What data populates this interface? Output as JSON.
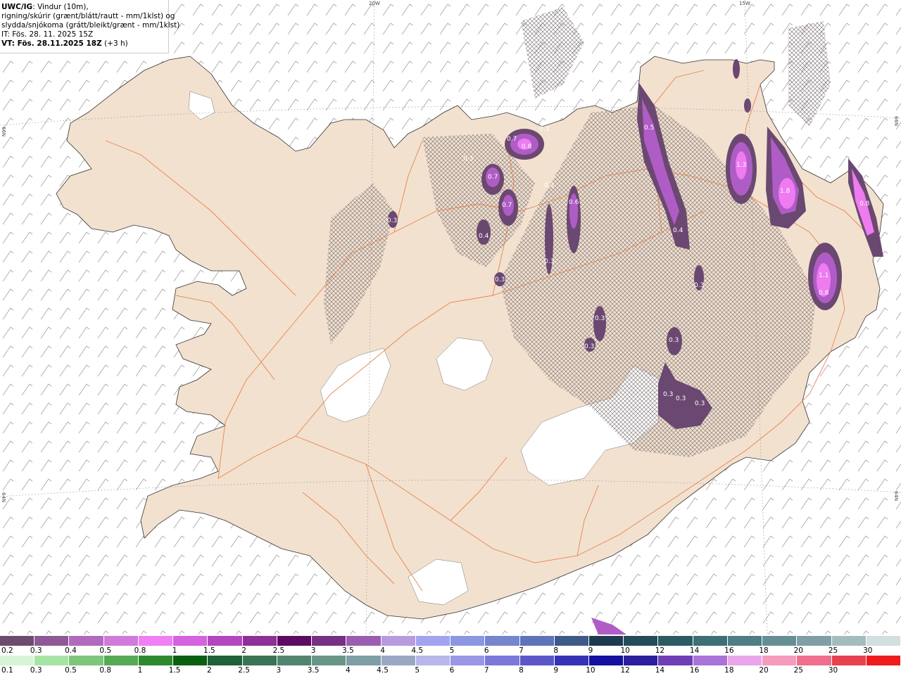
{
  "header": {
    "model": "UWC/IG",
    "line1_rest": ": Vindur (10m),",
    "line2": "rigning/skúrir (grænt/blátt/rautt - mm/1klst) og",
    "line3": "slydda/snjókoma (grátt/bleikt/grænt - mm/1klst)",
    "it_line": "IT: Fös. 28. 11. 2025 15Z",
    "vt_bold": "VT: Fös. 28.11.2025 18Z",
    "vt_offset": " (+3 h)"
  },
  "grid_labels": {
    "top_20w": "20W",
    "top_15w": "15W",
    "left_66n": "66N",
    "right_66n": "66N",
    "left_64n": "64N",
    "right_64n": "64N"
  },
  "precip_labels": [
    "0.7",
    "0.8",
    "0.3",
    "0.3",
    "0.7",
    "0.3",
    "0.7",
    "0.4",
    "0.3",
    "0.6",
    "0.3",
    "0.3",
    "0.5",
    "0.4",
    "1.3",
    "1.8",
    "0.8",
    "1.1",
    "0.8",
    "0.3",
    "0.3",
    "0.3",
    "0.3",
    "0.3",
    "0.3",
    "0.3"
  ],
  "colors": {
    "land": "#f2e1cf",
    "roads": "#e8834f",
    "glacier": "#ffffff",
    "ocean": "#ffffff",
    "hatch": "#8a7f80",
    "precip_light": "#6b4871",
    "precip_mid": "#b05cc6",
    "precip_high": "#ee7bf0"
  },
  "snow_scale": {
    "ticks": [
      "0.2",
      "0.3",
      "0.4",
      "0.5",
      "0.8",
      "1",
      "1.5",
      "2",
      "2.5",
      "3",
      "3.5",
      "4",
      "4.5",
      "5",
      "6",
      "7",
      "8",
      "9",
      "10",
      "12",
      "14",
      "16",
      "18",
      "20",
      "25",
      "30"
    ],
    "colors": [
      "#6b4b6e",
      "#8e5a96",
      "#b16abd",
      "#d07ad9",
      "#f07ff5",
      "#d562df",
      "#b447bd",
      "#8f2f98",
      "#5c0b62",
      "#763084",
      "#9a5db1",
      "#b79bdf",
      "#a3a3f0",
      "#8c97e2",
      "#7586cf",
      "#5f74b8",
      "#3e5a88",
      "#1d3a4f",
      "#234c58",
      "#2d5b64",
      "#3d6f75",
      "#4f7c85",
      "#668e95",
      "#809fa5",
      "#a5bcbf",
      "#d3dedf"
    ]
  },
  "rain_scale": {
    "ticks": [
      "0.1",
      "0.3",
      "0.5",
      "0.8",
      "1",
      "1.5",
      "2",
      "2.5",
      "3",
      "3.5",
      "4",
      "4.5",
      "5",
      "6",
      "7",
      "8",
      "9",
      "10",
      "12",
      "14",
      "16",
      "18",
      "20",
      "25",
      "30"
    ],
    "colors": [
      "#d6f5d6",
      "#a8e3a6",
      "#7ec67d",
      "#58a956",
      "#2f8a2f",
      "#0b5f12",
      "#20603a",
      "#3a7355",
      "#52856f",
      "#699589",
      "#7f9ea5",
      "#9aa8c3",
      "#b7b7ec",
      "#9997e6",
      "#7b78d9",
      "#5b57c9",
      "#3632b5",
      "#1410a0",
      "#2b1f9e",
      "#6e3fb5",
      "#a874d7",
      "#e9a6e8",
      "#f59bbc",
      "#ef6f8c",
      "#e8414f",
      "#ee1c1c"
    ]
  }
}
